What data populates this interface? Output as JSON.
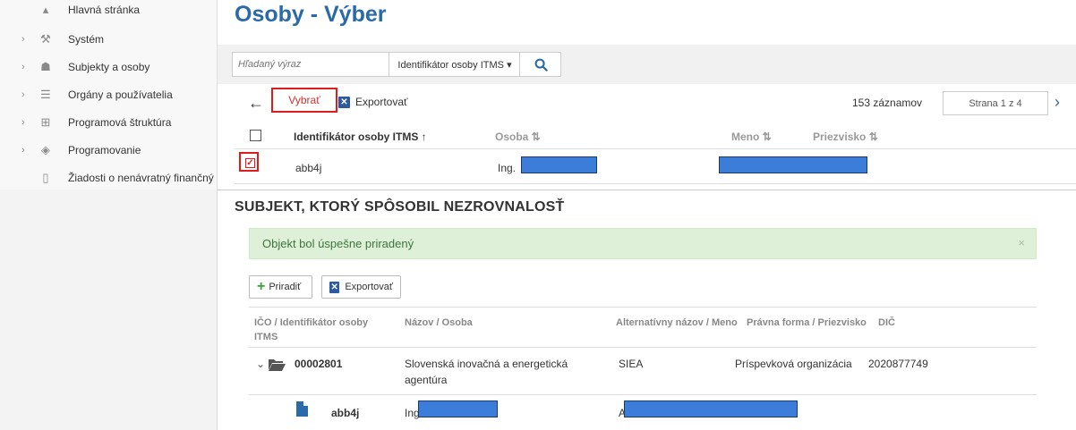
{
  "sidebar": {
    "items": [
      {
        "label": "Hlavná stránka",
        "icon": "home-icon",
        "has_chevron": false
      },
      {
        "label": "Systém",
        "icon": "wrench-icon",
        "has_chevron": true
      },
      {
        "label": "Subjekty a osoby",
        "icon": "people-icon",
        "has_chevron": true
      },
      {
        "label": "Orgány a používatelia",
        "icon": "user-list-icon",
        "has_chevron": true
      },
      {
        "label": "Programová štruktúra",
        "icon": "hierarchy-icon",
        "has_chevron": true
      },
      {
        "label": "Programovanie",
        "icon": "boxes-icon",
        "has_chevron": true
      },
      {
        "label": "Žiadosti o nenávratný finančný",
        "icon": "document-icon",
        "has_chevron": false
      }
    ]
  },
  "header": {
    "title": "Osoby - Výber"
  },
  "search": {
    "placeholder": "Hľadaný výraz",
    "field_select": "Identifikátor osoby ITMS ▾"
  },
  "toolbar": {
    "select_label": "Vybrať",
    "export_label": "Exportovať",
    "records": "153 záznamov",
    "page": "Strana 1 z 4"
  },
  "results_table": {
    "columns": [
      "Identifikátor osoby ITMS ↑",
      "Osoba ⇅",
      "Meno ⇅",
      "Priezvisko ⇅"
    ],
    "rows": [
      {
        "id": "abb4j",
        "osoba_prefix": "Ing.",
        "checked": true
      }
    ]
  },
  "subject_section": {
    "title": "SUBJEKT, KTORÝ SPÔSOBIL NEZROVNALOSŤ",
    "alert": "Objekt bol úspešne priradený",
    "alert_close": "×",
    "assign_label": "Priradiť",
    "export_label": "Exportovať",
    "columns": [
      "IČO / Identifikátor osoby ITMS",
      "Názov / Osoba",
      "Alternatívny názov / Meno",
      "Právna forma / Priezvisko",
      "DIČ"
    ],
    "rows": [
      {
        "ico": "00002801",
        "name": "Slovenská inovačná a energetická agentúra",
        "alt": "SIEA",
        "legal_form": "Príspevková organizácia",
        "dic": "2020877749"
      },
      {
        "ico": "abb4j",
        "name": "Ing",
        "alt": "A"
      }
    ]
  },
  "colors": {
    "accent": "#2a6aa8",
    "highlight_red": "#e01b1b",
    "redaction_blue": "#3b7dd8",
    "success_bg": "#dff0d8"
  }
}
